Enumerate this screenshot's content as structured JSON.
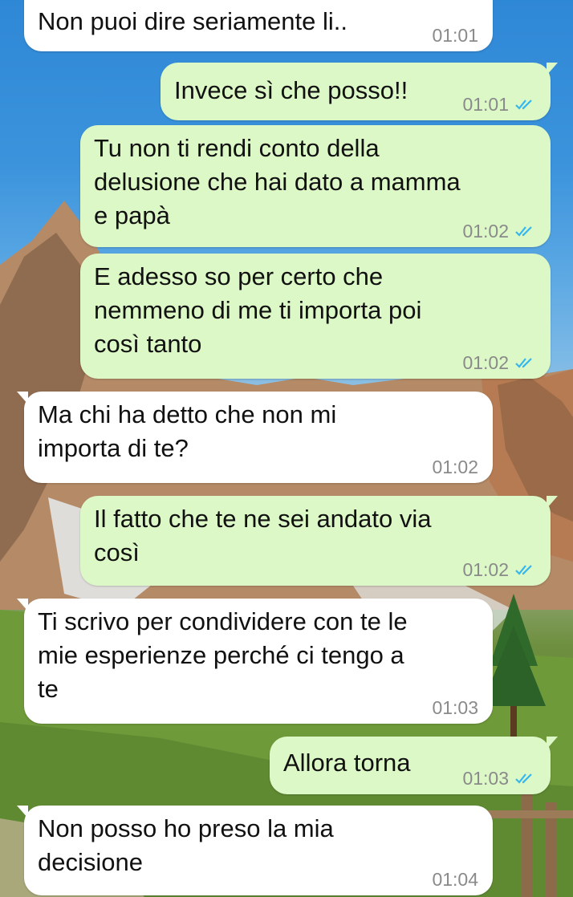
{
  "colors": {
    "incoming_bubble": "#ffffff",
    "outgoing_bubble": "#dcf8c6",
    "read_ticks": "#34b7f1",
    "time_text": "#8a8a8a"
  },
  "messages": [
    {
      "direction": "in",
      "text": "Non puoi dire seriamente li..",
      "time": "01:01"
    },
    {
      "direction": "out",
      "text": "Invece sì che posso!!",
      "time": "01:01",
      "status_icon": "double-check-icon"
    },
    {
      "direction": "out",
      "text": "Tu non ti rendi conto della\ndelusione che hai dato a mamma\ne papà",
      "time": "01:02",
      "status_icon": "double-check-icon"
    },
    {
      "direction": "out",
      "text": "E adesso so per certo che\nnemmeno di me ti importa poi\ncosì tanto",
      "time": "01:02",
      "status_icon": "double-check-icon"
    },
    {
      "direction": "in",
      "text": "Ma chi ha detto che non mi\nimporta di te?",
      "time": "01:02"
    },
    {
      "direction": "out",
      "text": "Il fatto che te ne sei andato via\ncosì",
      "time": "01:02",
      "status_icon": "double-check-icon"
    },
    {
      "direction": "in",
      "text": "Ti scrivo per condividere con te le\nmie esperienze perché ci tengo a\nte",
      "time": "01:03"
    },
    {
      "direction": "out",
      "text": "Allora torna",
      "time": "01:03",
      "status_icon": "double-check-icon"
    },
    {
      "direction": "in",
      "text": "Non posso ho preso la mia\ndecisione",
      "time": "01:04"
    }
  ]
}
